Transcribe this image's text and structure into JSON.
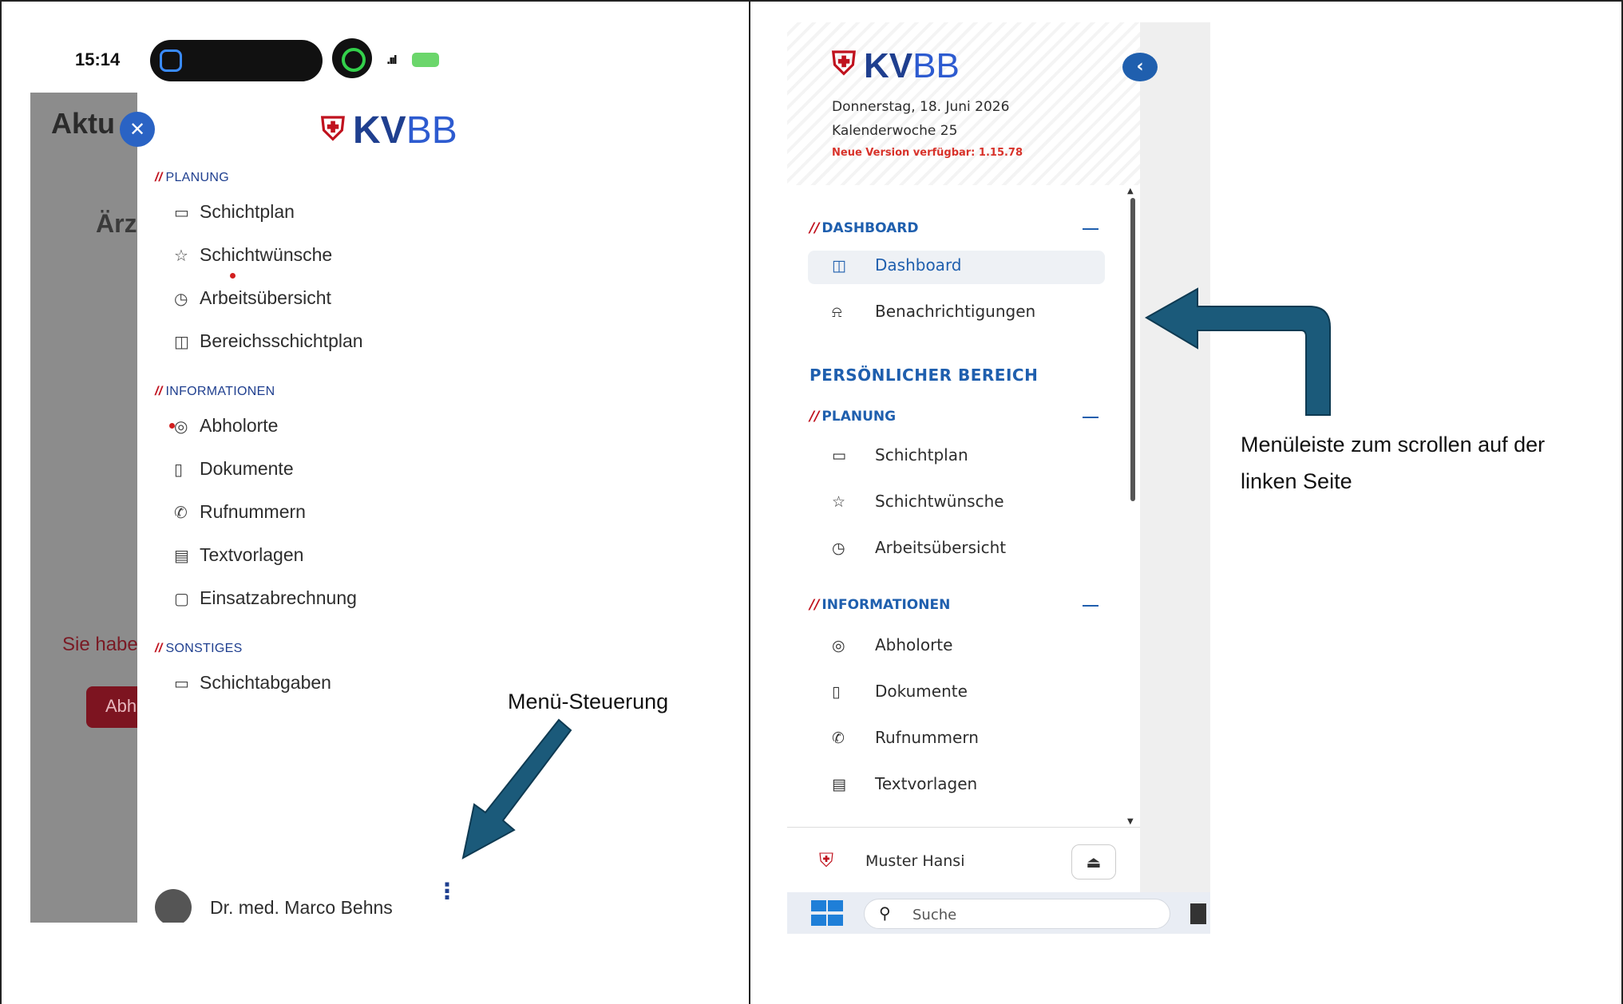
{
  "phone": {
    "status_time": "15:14",
    "back_title": "Aktu",
    "back_heading": "Ärzt",
    "back_notice": "Sie habe",
    "back_button": "Abh",
    "logo_kv": "KV",
    "logo_bb": "BB",
    "sections": [
      {
        "title": "PLANUNG",
        "items": [
          {
            "label": "Schichtplan",
            "icon": "calendar-icon"
          },
          {
            "label": "Schichtwünsche",
            "icon": "star-icon"
          },
          {
            "label": "Arbeitsübersicht",
            "icon": "clock-icon"
          },
          {
            "label": "Bereichsschichtplan",
            "icon": "columns-icon"
          }
        ]
      },
      {
        "title": "INFORMATIONEN",
        "items": [
          {
            "label": "Abholorte",
            "icon": "location-icon"
          },
          {
            "label": "Dokumente",
            "icon": "document-icon"
          },
          {
            "label": "Rufnummern",
            "icon": "phone-icon"
          },
          {
            "label": "Textvorlagen",
            "icon": "text-template-icon"
          },
          {
            "label": "Einsatzabrechnung",
            "icon": "clipboard-icon"
          }
        ]
      },
      {
        "title": "SONSTIGES",
        "items": [
          {
            "label": "Schichtabgaben",
            "icon": "calendar-icon"
          }
        ]
      }
    ],
    "user_name": "Dr. med. Marco Behns"
  },
  "callouts": {
    "menu_control": "Menü-Steuerung",
    "scroll_note": "Menüleiste zum scrollen auf der linken Seite"
  },
  "desktop": {
    "logo_kv": "KV",
    "logo_bb": "BB",
    "date": "Donnerstag, 18. Juni 2026",
    "week": "Kalenderwoche 25",
    "version_notice": "Neue Version verfügbar: 1.15.78",
    "dashboard_section": "DASHBOARD",
    "dashboard_items": [
      {
        "label": "Dashboard",
        "icon": "columns-icon",
        "active": true
      },
      {
        "label": "Benachrichtigungen",
        "icon": "bell-icon",
        "active": false
      }
    ],
    "personal_area": "PERSÖNLICHER BEREICH",
    "planning_section": "PLANUNG",
    "planning_items": [
      {
        "label": "Schichtplan",
        "icon": "calendar-icon"
      },
      {
        "label": "Schichtwünsche",
        "icon": "star-icon"
      },
      {
        "label": "Arbeitsübersicht",
        "icon": "clock-icon"
      }
    ],
    "info_section": "INFORMATIONEN",
    "info_items": [
      {
        "label": "Abholorte",
        "icon": "location-icon"
      },
      {
        "label": "Dokumente",
        "icon": "document-icon"
      },
      {
        "label": "Rufnummern",
        "icon": "phone-icon"
      },
      {
        "label": "Textvorlagen",
        "icon": "text-template-icon"
      }
    ],
    "user_name": "Muster Hansi",
    "taskbar_search": "Suche"
  },
  "colors": {
    "brand_blue": "#1f5fae",
    "brand_red": "#c0121e",
    "arrow_fill": "#1b5a7a"
  }
}
